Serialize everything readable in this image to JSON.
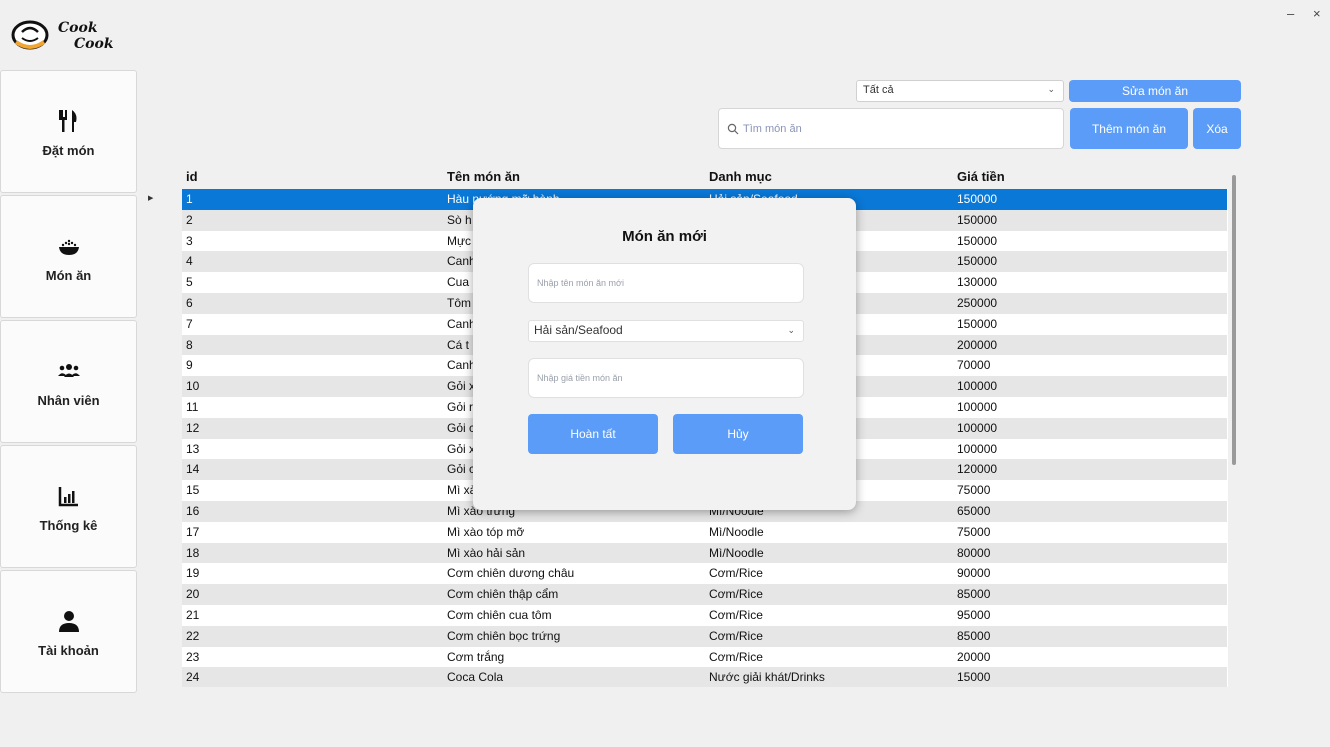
{
  "window": {
    "minimize": "–",
    "close": "×"
  },
  "logo": {
    "line1": "Cook",
    "line2": "Cook"
  },
  "sidebar": {
    "items": [
      {
        "label": "Đặt món",
        "icon": "fork-knife-icon"
      },
      {
        "label": "Món ăn",
        "icon": "food-bowl-icon"
      },
      {
        "label": "Nhân viên",
        "icon": "users-icon"
      },
      {
        "label": "Thống kê",
        "icon": "bar-chart-icon"
      },
      {
        "label": "Tài khoản",
        "icon": "user-icon"
      }
    ]
  },
  "toolbar": {
    "filter_value": "Tất cả",
    "edit_label": "Sửa món ăn",
    "search_placeholder": "Tìm món ăn",
    "add_label": "Thêm món ăn",
    "delete_label": "Xóa"
  },
  "table": {
    "columns": [
      "id",
      "Tên món ăn",
      "Danh mục",
      "Giá tiền"
    ],
    "rows": [
      [
        "1",
        "Hàu nướng mỡ hành",
        "Hải sản/Seafood",
        "150000"
      ],
      [
        "2",
        "Sò h",
        "",
        "150000"
      ],
      [
        "3",
        "Mực",
        "",
        "150000"
      ],
      [
        "4",
        "Canh",
        "",
        "150000"
      ],
      [
        "5",
        "Cua",
        "",
        "130000"
      ],
      [
        "6",
        "Tôm",
        "",
        "250000"
      ],
      [
        "7",
        "Canh",
        "",
        "150000"
      ],
      [
        "8",
        "Cá t",
        "",
        "200000"
      ],
      [
        "9",
        "Canh",
        "",
        "70000"
      ],
      [
        "10",
        "Gỏi x",
        "",
        "100000"
      ],
      [
        "11",
        "Gỏi r",
        "",
        "100000"
      ],
      [
        "12",
        "Gỏi c",
        "",
        "100000"
      ],
      [
        "13",
        "Gỏi x",
        "",
        "100000"
      ],
      [
        "14",
        "Gỏi c",
        "",
        "120000"
      ],
      [
        "15",
        "Mì xà",
        "",
        "75000"
      ],
      [
        "16",
        "Mì xào trứng",
        "Mì/Noodle",
        "65000"
      ],
      [
        "17",
        "Mì xào tóp mỡ",
        "Mì/Noodle",
        "75000"
      ],
      [
        "18",
        "Mì xào hải sản",
        "Mì/Noodle",
        "80000"
      ],
      [
        "19",
        "Cơm chiên dương châu",
        "Cơm/Rice",
        "90000"
      ],
      [
        "20",
        "Cơm chiên thập cẩm",
        "Cơm/Rice",
        "85000"
      ],
      [
        "21",
        "Cơm chiên cua tôm",
        "Cơm/Rice",
        "95000"
      ],
      [
        "22",
        "Cơm chiên bọc trứng",
        "Cơm/Rice",
        "85000"
      ],
      [
        "23",
        "Cơm trắng",
        "Cơm/Rice",
        "20000"
      ],
      [
        "24",
        "Coca Cola",
        "Nước giải khát/Drinks",
        "15000"
      ]
    ]
  },
  "modal": {
    "title": "Món ăn mới",
    "name_placeholder": "Nhập tên món ăn mới",
    "category_value": "Hải sản/Seafood",
    "price_placeholder": "Nhập giá tiền món ăn",
    "confirm_label": "Hoàn tất",
    "cancel_label": "Hủy"
  },
  "colors": {
    "accent": "#5b9cf8",
    "selected_row": "#0a78d7"
  }
}
